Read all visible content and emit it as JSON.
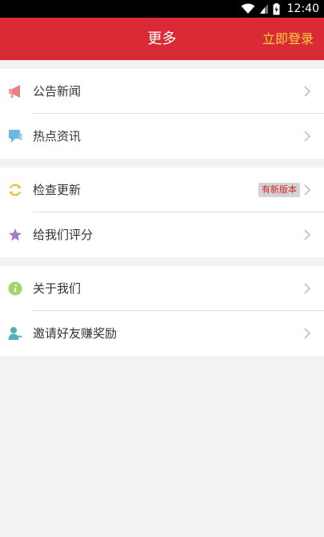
{
  "status_bar": {
    "time": "12:40"
  },
  "header": {
    "title": "更多",
    "login_label": "立即登录"
  },
  "groups": [
    {
      "items": [
        {
          "label": "公告新闻",
          "icon": "megaphone-icon"
        },
        {
          "label": "热点资讯",
          "icon": "chat-bubble-icon"
        }
      ]
    },
    {
      "items": [
        {
          "label": "检查更新",
          "icon": "refresh-icon",
          "badge": "有新版本"
        },
        {
          "label": "给我们评分",
          "icon": "star-icon"
        }
      ]
    },
    {
      "items": [
        {
          "label": "关于我们",
          "icon": "info-icon"
        },
        {
          "label": "邀请好友赚奖励",
          "icon": "invite-user-icon"
        }
      ]
    }
  ],
  "colors": {
    "header": "#d92a35",
    "login": "#ffd23f",
    "badge_text": "#d9242f"
  }
}
